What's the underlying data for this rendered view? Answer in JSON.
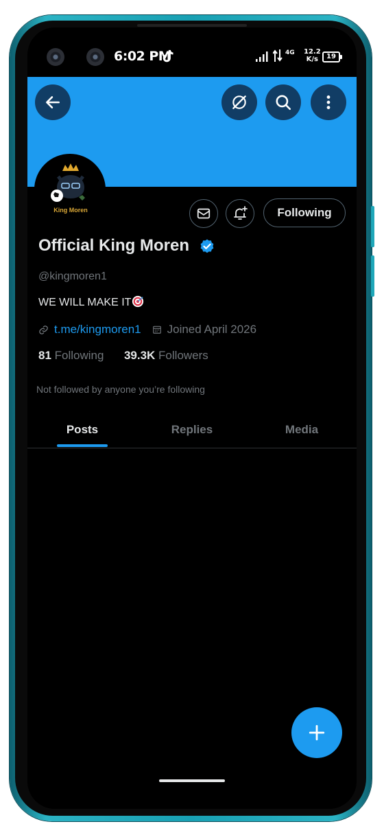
{
  "status_bar": {
    "time": "6:02 PM",
    "network_type": "4G",
    "net_speed_value": "12.2",
    "net_speed_unit": "K/s",
    "battery_level": "19",
    "icons": [
      "camera-icon",
      "tiktok-icon",
      "signal-icon",
      "data-arrows-icon",
      "battery-icon"
    ]
  },
  "header": {
    "banner_color": "#1d9bf0",
    "icons": [
      "back-arrow-icon",
      "grok-icon",
      "search-icon",
      "more-vertical-icon"
    ]
  },
  "profile": {
    "avatar_label": "King Moren",
    "display_name": "Official King Moren",
    "handle": "@kingmoren1",
    "bio": "WE WILL MAKE IT",
    "bio_emoji": "direct-hit-target-icon",
    "link": "t.me/kingmoren1",
    "joined": "Joined April 2026",
    "following_count": "81",
    "following_label": "Following",
    "followers_count": "39.3K",
    "followers_label": "Followers",
    "followed_by_note": "Not followed by anyone you’re following"
  },
  "actions": {
    "message_icon": "mail-icon",
    "notify_icon": "bell-plus-icon",
    "follow_state_label": "Following"
  },
  "tabs": [
    {
      "label": "Posts",
      "active": true
    },
    {
      "label": "Replies",
      "active": false
    },
    {
      "label": "Media",
      "active": false
    }
  ],
  "fab": {
    "icon": "plus-icon"
  },
  "colors": {
    "accent": "#1d9bf0",
    "background": "#000000",
    "text_primary": "#e7e9ea",
    "text_secondary": "#71767b",
    "phone_frame": "#1fa7b9"
  }
}
